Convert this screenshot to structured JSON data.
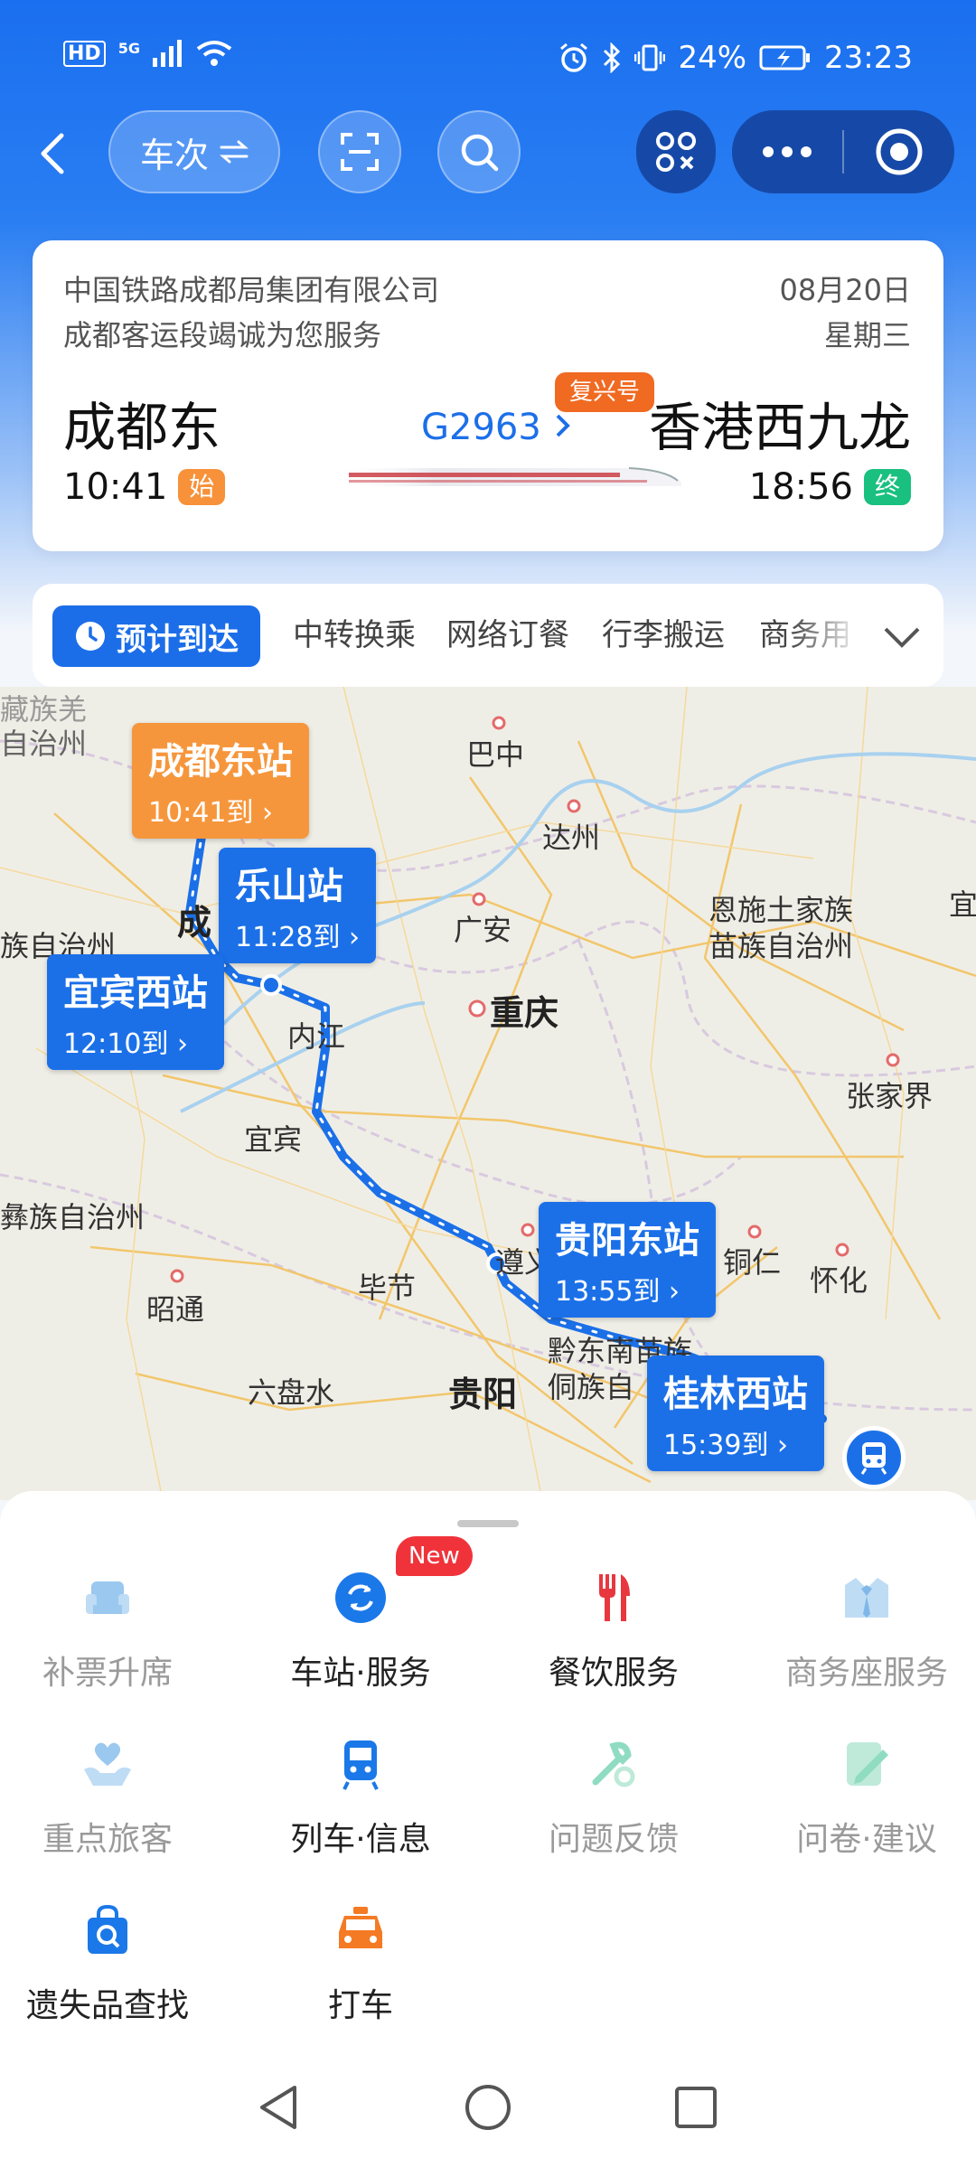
{
  "status_bar": {
    "hd": "HD",
    "network": "5G",
    "battery": "24%",
    "time": "23:23"
  },
  "topbar": {
    "train_toggle_label": "车次"
  },
  "train": {
    "company_line1": "中国铁路成都局集团有限公司",
    "company_line2": "成都客运段竭诚为您服务",
    "date": "08月20日",
    "weekday": "星期三",
    "from_station": "成都东",
    "from_time": "10:41",
    "start_tag": "始",
    "to_station": "香港西九龙",
    "to_time": "18:56",
    "end_tag": "终",
    "train_no": "G2963",
    "train_type": "复兴号"
  },
  "tabs": {
    "active": "预计到达",
    "items": [
      "中转换乘",
      "网络订餐",
      "行李搬运",
      "商务用"
    ]
  },
  "map": {
    "cities": [
      "藏族羌",
      "自治州",
      "巴中",
      "达州",
      "恩施土家族",
      "苗族自治州",
      "广安",
      "重庆",
      "内江",
      "宜宾",
      "张家界",
      "彝族自治州",
      "遵义",
      "铜仁",
      "怀化",
      "毕节",
      "昭通",
      "黔东南苗族",
      "侗族自",
      "贵阳",
      "六盘水",
      "族自治州",
      "宜",
      "成"
    ],
    "stops": [
      {
        "name": "成都东站",
        "time": "10:41到"
      },
      {
        "name": "乐山站",
        "time": "11:28到"
      },
      {
        "name": "宜宾西站",
        "time": "12:10到"
      },
      {
        "name": "贵阳东站",
        "time": "13:55到"
      },
      {
        "name": "桂林西站",
        "time": "15:39到"
      }
    ],
    "route_color": "#1b70e8"
  },
  "services": {
    "new_badge": "New",
    "items": [
      {
        "label": "补票升席",
        "icon": "seat-upgrade-icon"
      },
      {
        "label": "车站·服务",
        "icon": "station-service-icon"
      },
      {
        "label": "餐饮服务",
        "icon": "dining-icon"
      },
      {
        "label": "商务座服务",
        "icon": "business-seat-icon"
      },
      {
        "label": "重点旅客",
        "icon": "priority-passenger-icon"
      },
      {
        "label": "列车·信息",
        "icon": "train-info-icon"
      },
      {
        "label": "问题反馈",
        "icon": "feedback-icon"
      },
      {
        "label": "问卷·建议",
        "icon": "survey-icon"
      },
      {
        "label": "遗失品查找",
        "icon": "lost-found-icon"
      },
      {
        "label": "打车",
        "icon": "taxi-icon"
      }
    ]
  }
}
